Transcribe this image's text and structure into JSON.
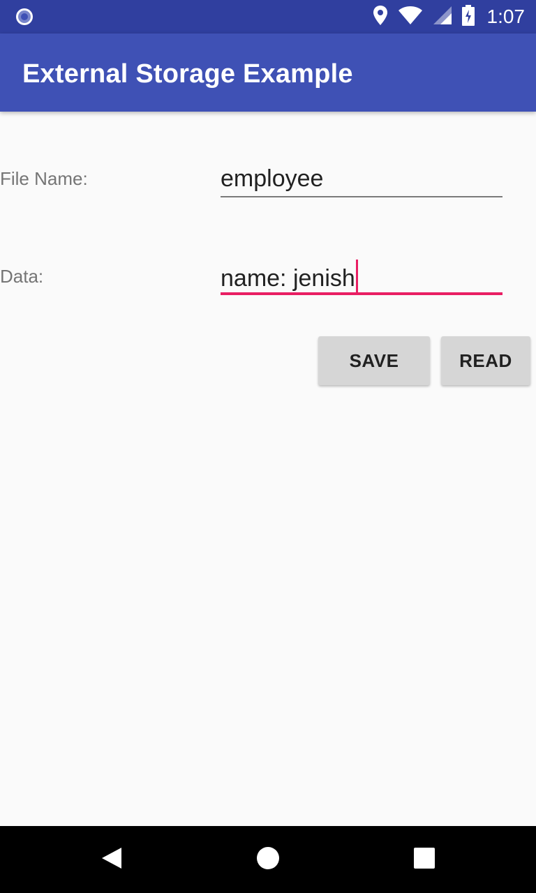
{
  "status_bar": {
    "time": "1:07",
    "icons": [
      "notification-dot-icon",
      "location-icon",
      "wifi-icon",
      "cellular-signal-icon",
      "battery-charging-icon"
    ]
  },
  "app_bar": {
    "title": "External Storage Example"
  },
  "form": {
    "file_name_label": "File Name:",
    "file_name_value": "employee",
    "data_label": "Data:",
    "data_value": "name: jenish"
  },
  "buttons": {
    "save_label": "SAVE",
    "read_label": "READ"
  },
  "colors": {
    "status_bar": "#303f9f",
    "app_bar": "#3f51b5",
    "accent": "#e91e63",
    "background": "#fafafa"
  },
  "nav_bar": {
    "icons": [
      "back-icon",
      "home-icon",
      "recents-icon"
    ]
  }
}
